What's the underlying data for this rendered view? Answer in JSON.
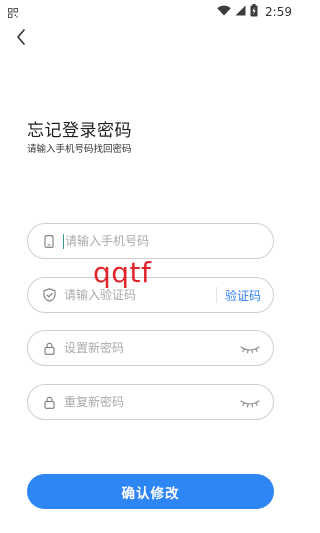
{
  "status_bar": {
    "time": "2:59",
    "icons": [
      "qr-icon",
      "wifi-icon",
      "signal-icon",
      "battery-charging-icon"
    ]
  },
  "header": {
    "back_icon": "chevron-left-icon"
  },
  "page": {
    "title": "忘记登录密码",
    "subtitle": "请输入手机号码找回密码"
  },
  "form": {
    "phone": {
      "placeholder": "请输入手机号码",
      "value": "",
      "icon": "phone-icon"
    },
    "code": {
      "placeholder": "请输入验证码",
      "value": "",
      "icon": "shield-check-icon",
      "button_label": "验证码"
    },
    "new_password": {
      "placeholder": "设置新密码",
      "value": "",
      "icon": "lock-icon",
      "toggle_icon": "eye-closed-icon"
    },
    "repeat_password": {
      "placeholder": "重复新密码",
      "value": "",
      "icon": "lock-icon",
      "toggle_icon": "eye-closed-icon"
    }
  },
  "actions": {
    "confirm_label": "确认修改"
  },
  "watermark": "qqtf",
  "colors": {
    "accent": "#2e86f4",
    "link": "#2f7ff0",
    "field_border": "#cfcfcf",
    "placeholder": "#a9a9a9",
    "watermark": "#e0262b"
  }
}
